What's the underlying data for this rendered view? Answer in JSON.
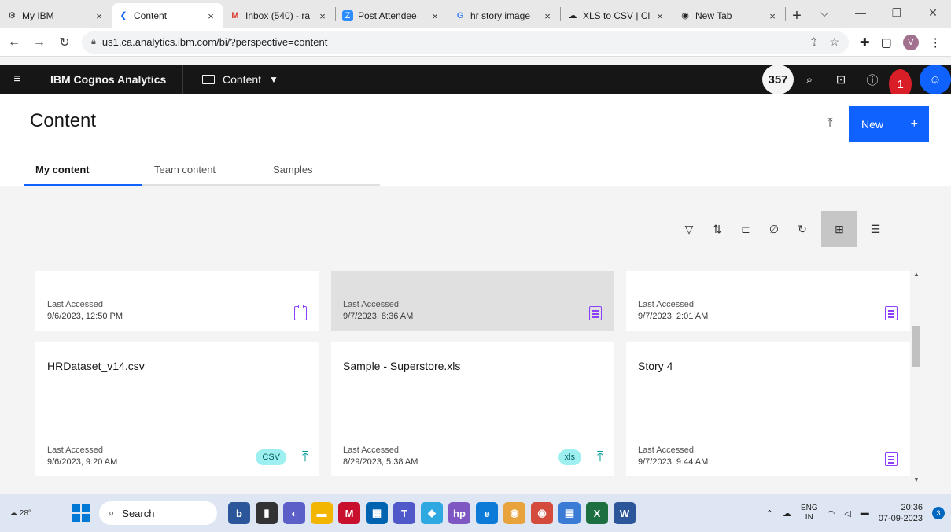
{
  "browser": {
    "tabs": [
      {
        "icon": "ibm-icon",
        "title": "My IBM",
        "close": "×"
      },
      {
        "icon": "cognos-icon",
        "title": "Content",
        "close": "×"
      },
      {
        "icon": "gmail-icon",
        "title": "Inbox (540) - ra",
        "close": "×"
      },
      {
        "icon": "zoho-icon",
        "title": "Post Attendee",
        "close": "×"
      },
      {
        "icon": "google-icon",
        "title": "hr story image",
        "close": "×"
      },
      {
        "icon": "cloud-icon",
        "title": "XLS to CSV | Cl",
        "close": "×"
      },
      {
        "icon": "chrome-icon",
        "title": "New Tab",
        "close": "×"
      }
    ],
    "new_tab": "+",
    "url": "us1.ca.analytics.ibm.com/bi/?perspective=content",
    "profile": "V"
  },
  "app": {
    "brand": "IBM Cognos Analytics",
    "context": "Content",
    "notif_count": "357",
    "bell_count": "1"
  },
  "page": {
    "title": "Content",
    "new_button": "New",
    "new_plus": "+",
    "tabs": [
      {
        "label": "My content",
        "active": true
      },
      {
        "label": "Team content",
        "active": false
      },
      {
        "label": "Samples",
        "active": false
      }
    ]
  },
  "toolbar": {
    "icons": [
      "filter-icon",
      "sort-icon",
      "new-folder-icon",
      "link-icon",
      "refresh-icon",
      "grid-view-icon",
      "list-view-icon"
    ]
  },
  "cards": [
    {
      "title": "",
      "accessed_label": "Last Accessed",
      "accessed": "9/6/2023, 12:50 PM",
      "type": "dashboard-icon"
    },
    {
      "title": "",
      "accessed_label": "Last Accessed",
      "accessed": "9/7/2023, 8:36 AM",
      "type": "report-icon"
    },
    {
      "title": "",
      "accessed_label": "Last Accessed",
      "accessed": "9/7/2023, 2:01 AM",
      "type": "report-icon"
    },
    {
      "title": "HRDataset_v14.csv",
      "accessed_label": "Last Accessed",
      "accessed": "9/6/2023, 9:20 AM",
      "pill": "CSV",
      "type": "upload-icon"
    },
    {
      "title": "Sample - Superstore.xls",
      "accessed_label": "Last Accessed",
      "accessed": "8/29/2023, 5:38 AM",
      "pill": "xls",
      "type": "upload-icon"
    },
    {
      "title": "Story 4",
      "accessed_label": "Last Accessed",
      "accessed": "9/7/2023, 9:44 AM",
      "type": "report-icon"
    }
  ],
  "taskbar": {
    "weather": "28°",
    "search": "Search",
    "lang_top": "ENG",
    "lang_bottom": "IN",
    "time": "20:36",
    "date": "07-09-2023",
    "notif_count": "3"
  },
  "colors": {
    "accent": "#0f62fe",
    "header": "#161616",
    "dataset_pill": "#9ef0f0",
    "icon_purple": "#8a3ffc",
    "upload_teal": "#009d9a"
  }
}
